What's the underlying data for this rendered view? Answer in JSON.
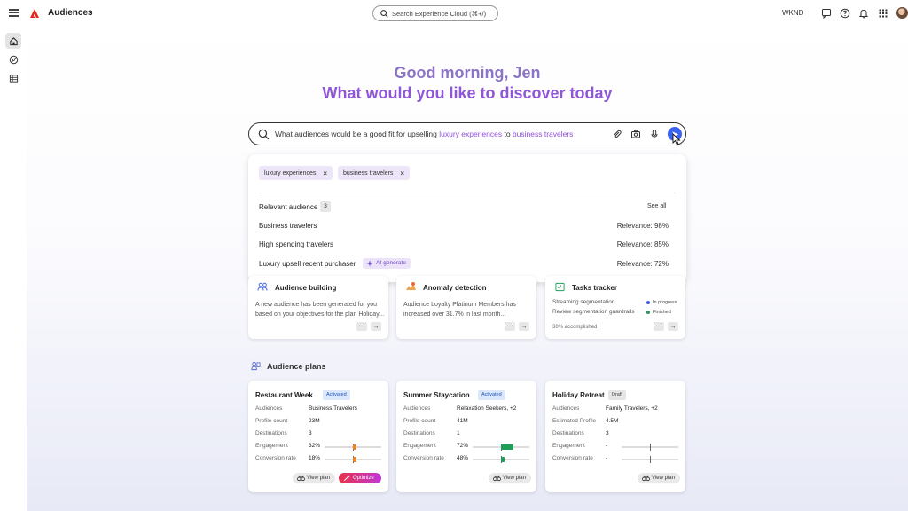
{
  "topbar": {
    "app_title": "Audiences",
    "search_placeholder": "Search Experience Cloud (⌘+/)",
    "org": "WKND"
  },
  "greeting": {
    "line1": "Good morning, Jen",
    "line2": "What would you like to discover today"
  },
  "prompt": {
    "pre": "What audiences would be a good fit for upselling ",
    "hl1": "luxury experiences",
    "mid": " to ",
    "hl2": "business travelers"
  },
  "dropdown": {
    "chips": [
      "luxury experiences",
      "business travelers"
    ],
    "relevant_label": "Relevant audience",
    "count": "3",
    "see_all": "See all",
    "rows": [
      {
        "name": "Business travelers",
        "relevance": "Relevance:  98%"
      },
      {
        "name": "High spending travelers",
        "relevance": "Relevance:  85%"
      },
      {
        "name": "Luxury upsell recent purchaser",
        "relevance": "Relevance: 72%",
        "badge": "AI-generate"
      }
    ]
  },
  "insights": [
    {
      "title": "Audience building",
      "desc1": "A new audience has been generated for you",
      "desc2": "based on your objectives for the plan Holiday..."
    },
    {
      "title": "Anomaly detection",
      "desc1": "Audience Loyalty Platinum Members has",
      "desc2": "increased over 31.7% in last month..."
    },
    {
      "title": "Tasks tracker",
      "task1": "Streaming segmentation",
      "status1": "In progress",
      "task2": "Review segmentation guardrails",
      "status2": "Finished",
      "footer": "30% accomplished"
    }
  ],
  "plans_section": "Audience plans",
  "plans": [
    {
      "title": "Restaurant Week",
      "status": "Activated",
      "labels": [
        "Audiences",
        "Profile count",
        "Destinations",
        "Engagement",
        "Conversion rate"
      ],
      "values": [
        "Business Travelers",
        "23M",
        "3",
        "32%",
        "18%"
      ],
      "bars": [
        0.32,
        0.18
      ],
      "view": "View plan",
      "optimize": "Optimize"
    },
    {
      "title": "Summer Staycation",
      "status": "Activated",
      "labels": [
        "Audiences",
        "Profile count",
        "Destinations",
        "Engagement",
        "Conversion rate"
      ],
      "values": [
        "Relaxation Seekers, +2",
        "41M",
        "1",
        "72%",
        "48%"
      ],
      "bars": [
        0.72,
        0.48
      ],
      "view": "View plan"
    },
    {
      "title": "Holiday Retreat",
      "status": "Draft",
      "labels": [
        "Audiences",
        "Estimated Profile",
        "Destinations",
        "Engagement",
        "Conversion rate"
      ],
      "values": [
        "Family Travelers, +2",
        "4.5M",
        "3",
        "-",
        "-"
      ],
      "bars": [
        null,
        null
      ],
      "view": "View plan"
    }
  ],
  "colors": {
    "accent_purple": "#8f56d8",
    "send_blue": "#3b63f0",
    "bar_orange": "#e8822c",
    "bar_green": "#1f9e5a",
    "in_progress": "#3b63f0",
    "finished": "#1f9e5a"
  }
}
